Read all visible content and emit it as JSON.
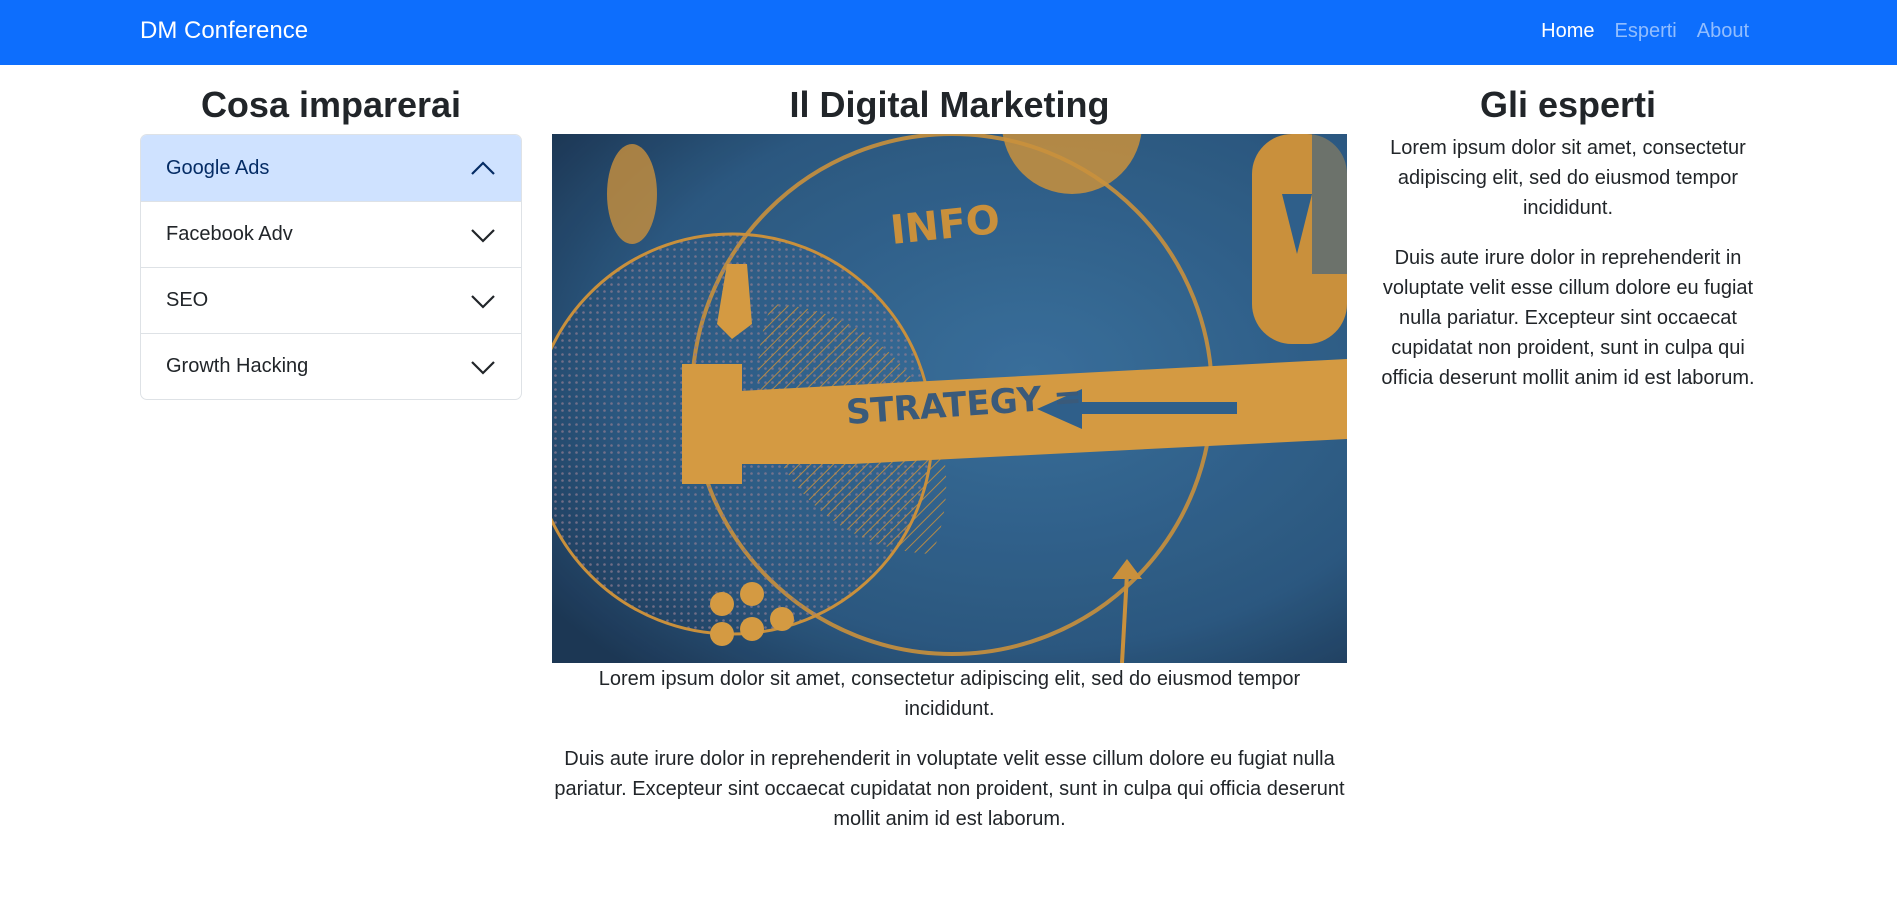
{
  "navbar": {
    "brand": "DM Conference",
    "links": [
      {
        "label": "Home",
        "active": true
      },
      {
        "label": "Esperti",
        "active": false
      },
      {
        "label": "About",
        "active": false
      }
    ],
    "color": "#0d6efd"
  },
  "left": {
    "title": "Cosa imparerai",
    "accordion": [
      {
        "label": "Google Ads",
        "open": true
      },
      {
        "label": "Facebook Adv",
        "open": false
      },
      {
        "label": "SEO",
        "open": false
      },
      {
        "label": "Growth Hacking",
        "open": false
      }
    ]
  },
  "main": {
    "title": "Il Digital Marketing",
    "image": {
      "label_info": "INFO",
      "label_strategy": "STRATEGY ="
    },
    "paragraphs": [
      "Lorem ipsum dolor sit amet, consectetur adipiscing elit, sed do eiusmod tempor incididunt.",
      "Duis aute irure dolor in reprehenderit in voluptate velit esse cillum dolore eu fugiat nulla pariatur. Excepteur sint occaecat cupidatat non proident, sunt in culpa qui officia deserunt mollit anim id est laborum."
    ]
  },
  "right": {
    "title": "Gli esperti",
    "paragraphs": [
      "Lorem ipsum dolor sit amet, consectetur adipiscing elit, sed do eiusmod tempor incididunt.",
      "Duis aute irure dolor in reprehenderit in voluptate velit esse cillum dolore eu fugiat nulla pariatur. Excepteur sint occaecat cupidatat non proident, sunt in culpa qui officia deserunt mollit anim id est laborum."
    ]
  }
}
